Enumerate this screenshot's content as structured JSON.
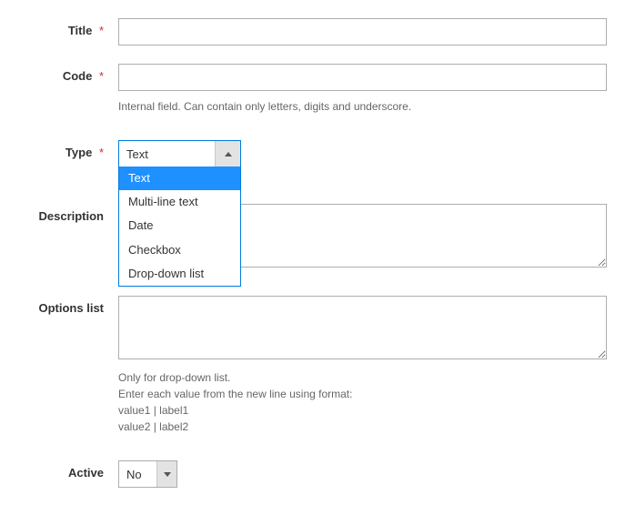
{
  "fields": {
    "title": {
      "label": "Title",
      "value": ""
    },
    "code": {
      "label": "Code",
      "value": "",
      "hint": "Internal field. Can contain only letters, digits and underscore."
    },
    "type": {
      "label": "Type",
      "selected": "Text",
      "options": [
        "Text",
        "Multi-line text",
        "Date",
        "Checkbox",
        "Drop-down list"
      ]
    },
    "description": {
      "label": "Description",
      "value": ""
    },
    "options_list": {
      "label": "Options list",
      "value": "",
      "hint_line1": "Only for drop-down list.",
      "hint_line2": "Enter each value from the new line using format:",
      "hint_line3": "value1 | label1",
      "hint_line4": "value2 | label2"
    },
    "active": {
      "label": "Active",
      "selected": "No"
    }
  }
}
